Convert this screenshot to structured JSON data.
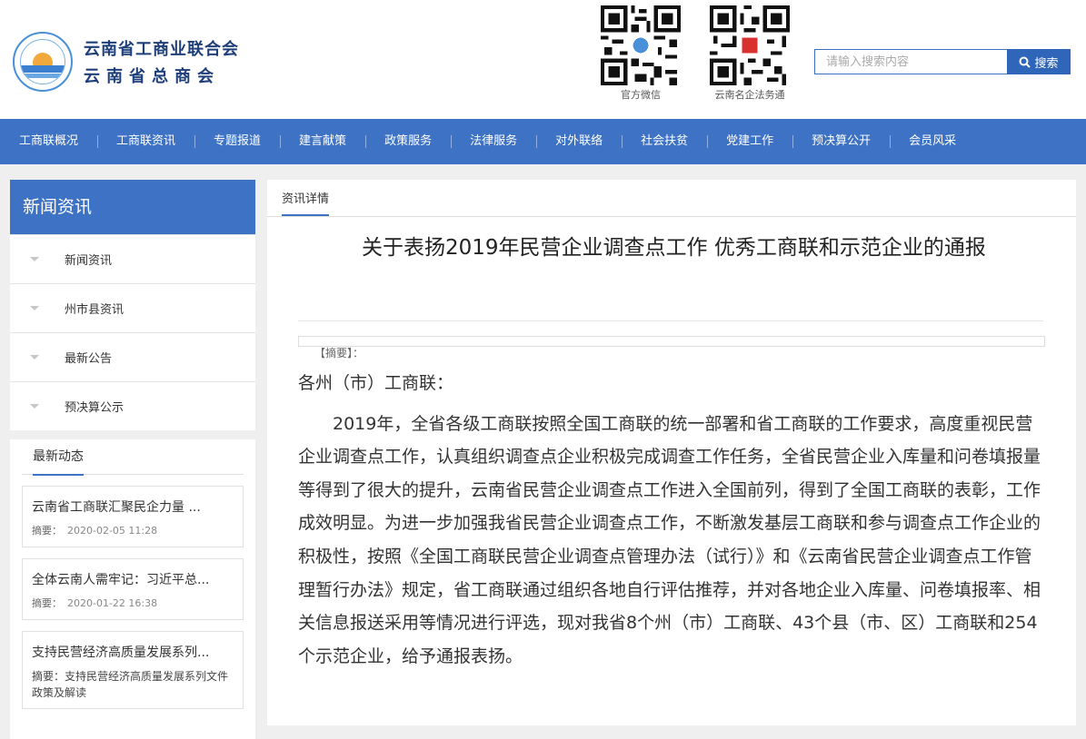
{
  "org": {
    "name_line1": "云南省工商业联合会",
    "name_line2": "云南省总商会"
  },
  "qr": [
    {
      "label": "官方微信"
    },
    {
      "label": "云南名企法务通"
    }
  ],
  "search": {
    "placeholder": "请输入搜索内容",
    "button": "搜索"
  },
  "nav": [
    "工商联概况",
    "工商联资讯",
    "专题报道",
    "建言献策",
    "政策服务",
    "法律服务",
    "对外联络",
    "社会扶贫",
    "党建工作",
    "预决算公开",
    "会员风采"
  ],
  "sidebar": {
    "title": "新闻资讯",
    "items": [
      "新闻资讯",
      "州市县资讯",
      "最新公告",
      "预决算公示"
    ],
    "latest_tab": "最新动态",
    "news": [
      {
        "title": "云南省工商联汇聚民企力量 ...",
        "meta_label": "摘要：",
        "meta_value": "2020-02-05 11:28"
      },
      {
        "title": "全体云南人需牢记：习近平总...",
        "meta_label": "摘要：",
        "meta_value": "2020-01-22 16:38"
      },
      {
        "title": "支持民营经济高质量发展系列...",
        "meta_label": "摘要：",
        "meta_value": "支持民营经济高质量发展系列文件政策及解读"
      }
    ]
  },
  "article": {
    "breadcrumb": "资讯详情",
    "title": "关于表扬2019年民营企业调查点工作 优秀工商联和示范企业的通报",
    "abstract": "【摘要】：",
    "salutation": "各州（市）工商联：",
    "paragraph": "2019年，全省各级工商联按照全国工商联的统一部署和省工商联的工作要求，高度重视民营企业调查点工作，认真组织调查点企业积极完成调查工作任务，全省民营企业入库量和问卷填报量等得到了很大的提升，云南省民营企业调查点工作进入全国前列，得到了全国工商联的表彰，工作成效明显。为进一步加强我省民营企业调查点工作，不断激发基层工商联和参与调查点工作企业的积极性，按照《全国工商联民营企业调查点管理办法（试行）》和《云南省民营企业调查点工作管理暂行办法》规定，省工商联通过组织各地自行评估推荐，并对各地企业入库量、问卷填报率、相关信息报送采用等情况进行评选，现对我省8个州（市）工商联、43个县（市、区）工商联和254个示范企业，给予通报表扬。"
  },
  "colors": {
    "primary": "#3d72c4",
    "button": "#2f66b9"
  }
}
